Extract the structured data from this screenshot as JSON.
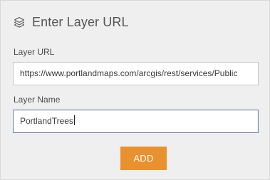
{
  "panel": {
    "title": "Enter Layer URL",
    "icon": "layers-icon"
  },
  "form": {
    "url_label": "Layer URL",
    "url_value": "https://www.portlandmaps.com/arcgis/rest/services/Public",
    "name_label": "Layer Name",
    "name_value": "PortlandTrees"
  },
  "actions": {
    "add_label": "ADD"
  },
  "colors": {
    "accent": "#e8912e",
    "panel_background": "#efefef"
  }
}
